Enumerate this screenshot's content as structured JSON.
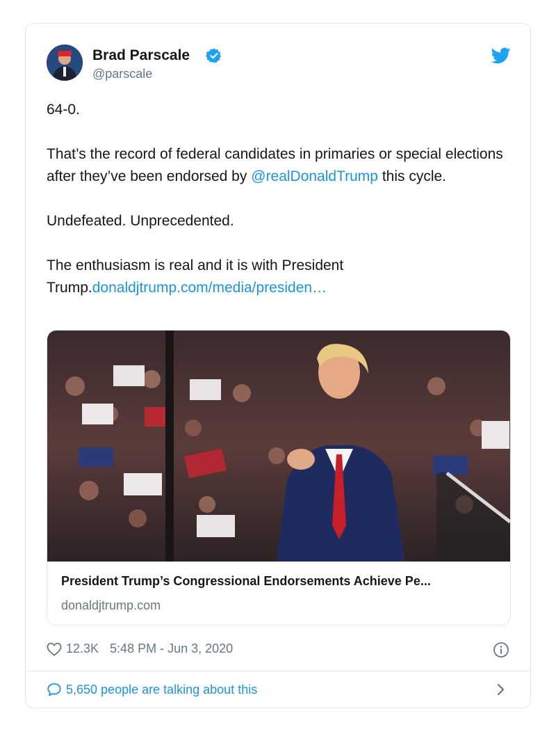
{
  "tweet": {
    "author_name": "Brad Parscale",
    "author_handle": "@parscale",
    "paragraphs": {
      "p1": "64-0.",
      "p2_before": "That’s the record of federal candidates in primaries or special elections after they’ve been endorsed by ",
      "p2_mention": "@realDonaldTrump",
      "p2_after": " this cycle.",
      "p3": "Undefeated. Unprecedented.",
      "p4_before": "The enthusiasm is real and it is with President Trump.",
      "p4_link": "donaldjtrump.com/media/presiden…"
    },
    "card": {
      "title": "President Trump’s Congressional Endorsements Achieve Pe...",
      "domain": "donaldjtrump.com"
    },
    "likes": "12.3K",
    "timestamp": "5:48 PM - Jun 3, 2020",
    "talking": "5,650 people are talking about this"
  },
  "colors": {
    "link": "#1b95e0",
    "secondary": "#657786",
    "border": "#e1e8ed"
  },
  "icons": [
    "verified-badge-icon",
    "twitter-bird-icon",
    "heart-icon",
    "info-icon",
    "comment-bubble-icon",
    "chevron-right-icon"
  ]
}
